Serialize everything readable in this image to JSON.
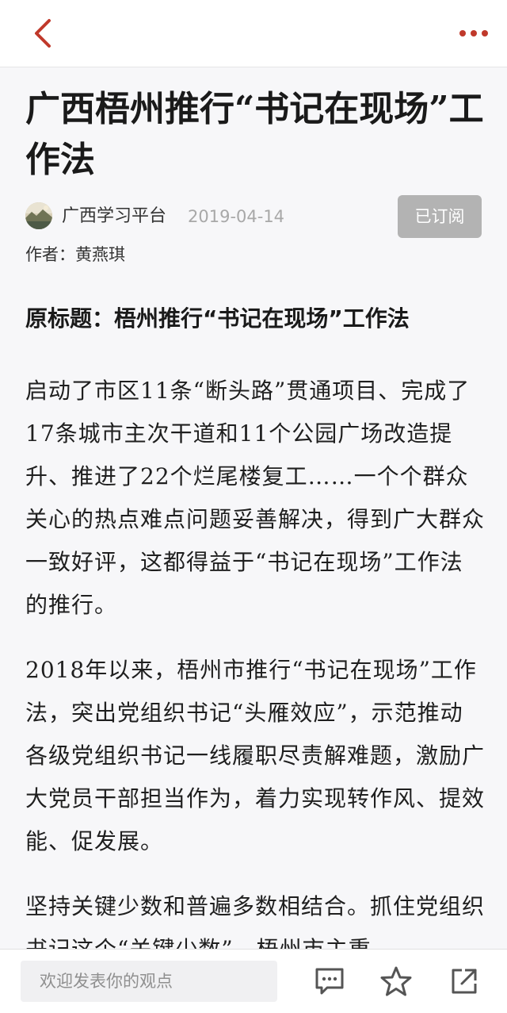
{
  "header": {
    "back_icon": "chevron-left-icon",
    "more_icon": "more-dots-icon",
    "accent_color": "#c0392b"
  },
  "article": {
    "title": "广西梧州推行“书记在现场”工作法",
    "source": "广西学习平台",
    "date": "2019-04-14",
    "subscribe_label": "已订阅",
    "author": "作者：黄燕琪",
    "subtitle": "原标题：梧州推行“书记在现场”工作法",
    "paragraphs": [
      "启动了市区11条“断头路”贯通项目、完成了17条城市主次干道和11个公园广场改造提升、推进了22个烂尾楼复工……一个个群众关心的热点难点问题妥善解决，得到广大群众一致好评，这都得益于“书记在现场”工作法的推行。",
      "2018年以来，梧州市推行“书记在现场”工作法，突出党组织书记“头雁效应”，示范推动各级党组织书记一线履职尽责解难题，激励广大党员干部担当作为，着力实现转作风、提效能、促发展。",
      "坚持关键少数和普遍多数相结合。抓住党组织书记这个“关键少数”，梧州市主重"
    ]
  },
  "bottom_bar": {
    "comment_placeholder": "欢迎发表你的观点",
    "icons": [
      "comment-icon",
      "star-icon",
      "share-icon"
    ]
  }
}
